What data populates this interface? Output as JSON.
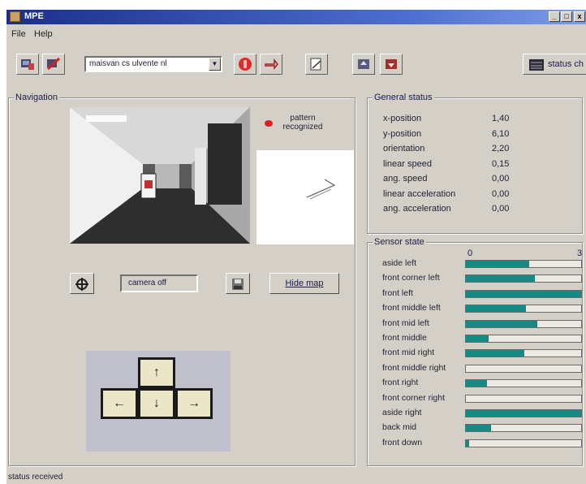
{
  "window": {
    "title": "MPE",
    "min_glyph": "_",
    "max_glyph": "□",
    "close_glyph": "x"
  },
  "menu": [
    "File",
    "Help"
  ],
  "toolbar": {
    "route_select_value": "maisvan cs ulvente nl",
    "status_button_label": "status ch",
    "icons": [
      "connect-icon",
      "disconnect-icon",
      "stop-icon",
      "refresh-icon",
      "map-view-icon",
      "camera-up-icon",
      "camera-down-icon",
      "status-icon"
    ]
  },
  "navigation": {
    "group_title": "Navigation",
    "pattern_label": "pattern recognized",
    "camera_select_value": "camera off",
    "hide_map_label": "Hide map",
    "keys": {
      "up": "↑",
      "left": "←",
      "down": "↓",
      "right": "→"
    }
  },
  "general_status": {
    "group_title": "General status",
    "rows": [
      {
        "label": "x-position",
        "value": "1,40"
      },
      {
        "label": "y-position",
        "value": "6,10"
      },
      {
        "label": "orientation",
        "value": "2,20"
      },
      {
        "label": "linear speed",
        "value": "0,15"
      },
      {
        "label": "ang. speed",
        "value": "0,00"
      },
      {
        "label": "linear acceleration",
        "value": "0,00"
      },
      {
        "label": "ang. acceleration",
        "value": "0,00"
      }
    ]
  },
  "sensor_state": {
    "group_title": "Sensor state",
    "scale_min": "0",
    "scale_max": "3",
    "sensors": [
      {
        "label": "aside left",
        "level": 0.55
      },
      {
        "label": "front corner left",
        "level": 0.6
      },
      {
        "label": "front left",
        "level": 1.0
      },
      {
        "label": "front middle left",
        "level": 0.52
      },
      {
        "label": "front mid left",
        "level": 0.62
      },
      {
        "label": "front middle",
        "level": 0.2
      },
      {
        "label": "front mid right",
        "level": 0.51
      },
      {
        "label": "front middle right",
        "level": 0.0
      },
      {
        "label": "front right",
        "level": 0.18
      },
      {
        "label": "front corner right",
        "level": 0.0
      },
      {
        "label": "aside right",
        "level": 1.0
      },
      {
        "label": "back mid",
        "level": 0.22
      },
      {
        "label": "front down",
        "level": 0.03
      }
    ],
    "bar_color": "#138a84"
  },
  "statusbar": {
    "text": "status received"
  }
}
